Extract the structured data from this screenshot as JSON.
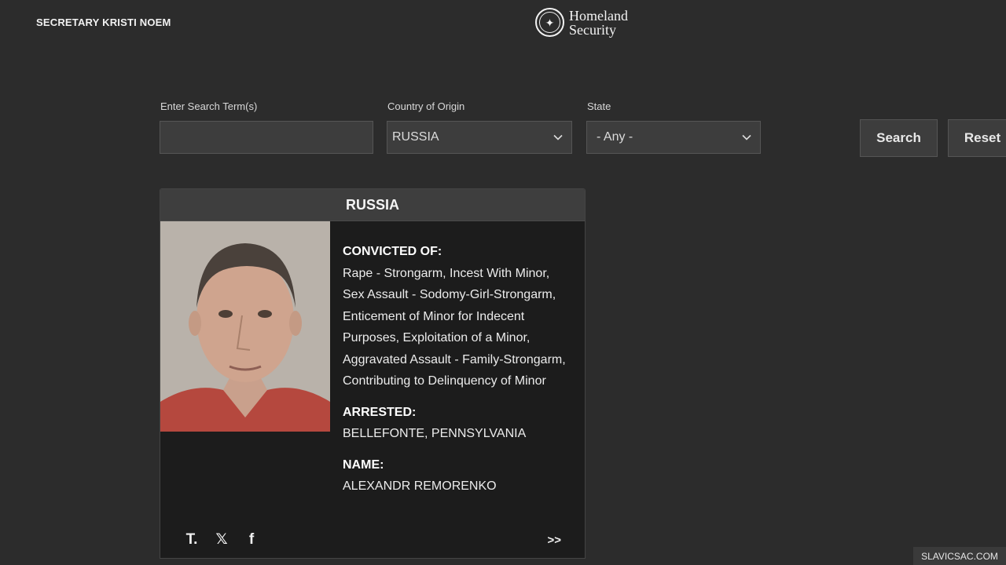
{
  "header": {
    "left_title": "SECRETARY KRISTI NOEM",
    "logo_line1": "Homeland",
    "logo_line2": "Security"
  },
  "search": {
    "term_label": "Enter Search Term(s)",
    "term_value": "",
    "country_label": "Country of Origin",
    "country_value": "RUSSIA",
    "state_label": "State",
    "state_value": "- Any -",
    "search_button": "Search",
    "reset_button": "Reset"
  },
  "card": {
    "header": "RUSSIA",
    "convicted_label": "CONVICTED OF:",
    "convicted_value": "Rape - Strongarm, Incest With Minor, Sex Assault - Sodomy-Girl-Strongarm, Enticement of Minor for Indecent Purposes, Exploitation of a Minor, Aggravated Assault - Family-Strongarm, Contributing to Delinquency of Minor",
    "arrested_label": "ARRESTED:",
    "arrested_value": "BELLEFONTE, PENNSYLVANIA",
    "name_label": "NAME:",
    "name_value": "ALEXANDR REMORENKO",
    "share_icons": [
      "truth-social-icon",
      "x-icon",
      "facebook-icon"
    ],
    "share_glyphs": [
      "T.",
      "𝕏",
      "f"
    ],
    "more_label": ">>"
  },
  "watermark": "SLAVICSAC.COM"
}
